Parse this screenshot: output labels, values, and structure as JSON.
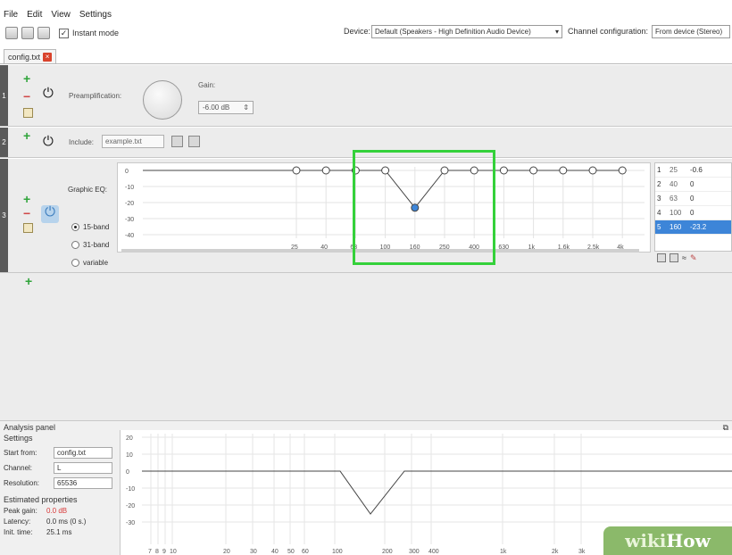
{
  "menu": [
    "File",
    "Edit",
    "View",
    "Settings"
  ],
  "toolbar": {
    "instant_mode_label": "Instant mode",
    "instant_mode_checked": true,
    "device_label": "Device:",
    "device_value": "Default (Speakers - High Definition Audio Device)",
    "channel_label": "Channel configuration:",
    "channel_value": "From device (Stereo)"
  },
  "tab": {
    "label": "config.txt"
  },
  "panel1": {
    "num": "1",
    "preamp_label": "Preamplification:",
    "gain_label": "Gain:",
    "gain_value": "-6.00 dB"
  },
  "panel2": {
    "num": "2",
    "include_label": "Include:",
    "include_value": "example.txt"
  },
  "panel3": {
    "num": "3",
    "graphic_eq_label": "Graphic EQ:",
    "band_options": [
      "15-band",
      "31-band",
      "variable"
    ],
    "selected_band": "15-band",
    "y_ticks": [
      "0",
      "-10",
      "-20",
      "-30",
      "-40"
    ],
    "x_ticks": [
      "25",
      "40",
      "63",
      "100",
      "160",
      "250",
      "400",
      "630",
      "1k",
      "1.6k",
      "2.5k",
      "4k"
    ],
    "table": [
      {
        "n": "1",
        "f": "25",
        "g": "-0.6"
      },
      {
        "n": "2",
        "f": "40",
        "g": "0"
      },
      {
        "n": "3",
        "f": "63",
        "g": "0"
      },
      {
        "n": "4",
        "f": "100",
        "g": "0"
      },
      {
        "n": "5",
        "f": "160",
        "g": "-23.2",
        "selected": true
      }
    ]
  },
  "analysis": {
    "title": "Analysis panel",
    "settings_head": "Settings",
    "start_from_label": "Start from:",
    "start_from_value": "config.txt",
    "channel_label": "Channel:",
    "channel_value": "L",
    "resolution_label": "Resolution:",
    "resolution_value": "65536",
    "estimated_head": "Estimated properties",
    "peak_gain_label": "Peak gain:",
    "peak_gain_value": "0.0 dB",
    "latency_label": "Latency:",
    "latency_value": "0.0 ms (0 s.)",
    "init_time_label": "Init. time:",
    "init_time_value": "25.1 ms",
    "y_ticks": [
      "20",
      "10",
      "0",
      "-10",
      "-20",
      "-30"
    ],
    "x_ticks": [
      "7",
      "8",
      "9",
      "10",
      "20",
      "30",
      "40",
      "50",
      "60",
      "100",
      "200",
      "300",
      "400",
      "1k",
      "2k",
      "3k"
    ]
  },
  "watermark": {
    "part1": "wiki",
    "part2": "How"
  },
  "colors": {
    "highlight": "#34d13a",
    "selection": "#3d85d8",
    "peak_gain": "#d83a3a"
  }
}
